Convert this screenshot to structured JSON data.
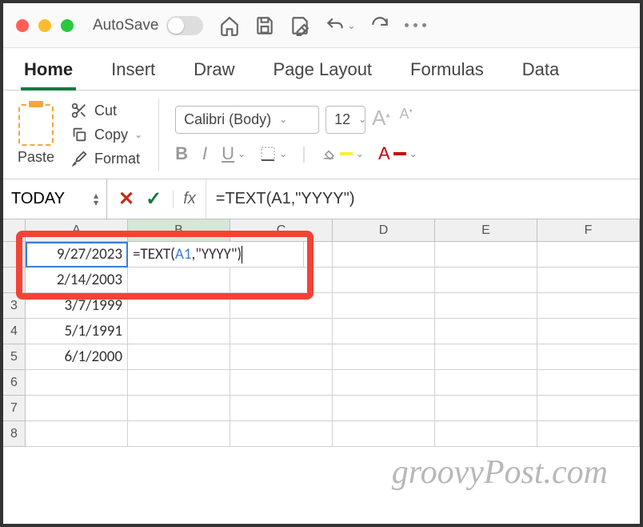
{
  "titlebar": {
    "autosave_label": "AutoSave"
  },
  "tabs": [
    "Home",
    "Insert",
    "Draw",
    "Page Layout",
    "Formulas",
    "Data"
  ],
  "active_tab": 0,
  "ribbon": {
    "paste_label": "Paste",
    "cut_label": "Cut",
    "copy_label": "Copy",
    "format_label": "Format",
    "font_name": "Calibri (Body)",
    "font_size": "12"
  },
  "formula_bar": {
    "name_box": "TODAY",
    "fx_label": "fx",
    "formula": "=TEXT(A1,\"YYYY\")"
  },
  "columns": [
    "A",
    "B",
    "C",
    "D",
    "E",
    "F"
  ],
  "rows": [
    {
      "num": "",
      "a": "9/27/2023",
      "b_formula": {
        "pre": "=TEXT(",
        "ref": "A1",
        "post": ",\"YYYY\")"
      }
    },
    {
      "num": "",
      "a": "2/14/2003"
    },
    {
      "num": "3",
      "a": "3/7/1999"
    },
    {
      "num": "4",
      "a": "5/1/1991"
    },
    {
      "num": "5",
      "a": "6/1/2000"
    },
    {
      "num": "6"
    },
    {
      "num": "7"
    },
    {
      "num": "8"
    }
  ],
  "watermark": "groovyPost.com"
}
